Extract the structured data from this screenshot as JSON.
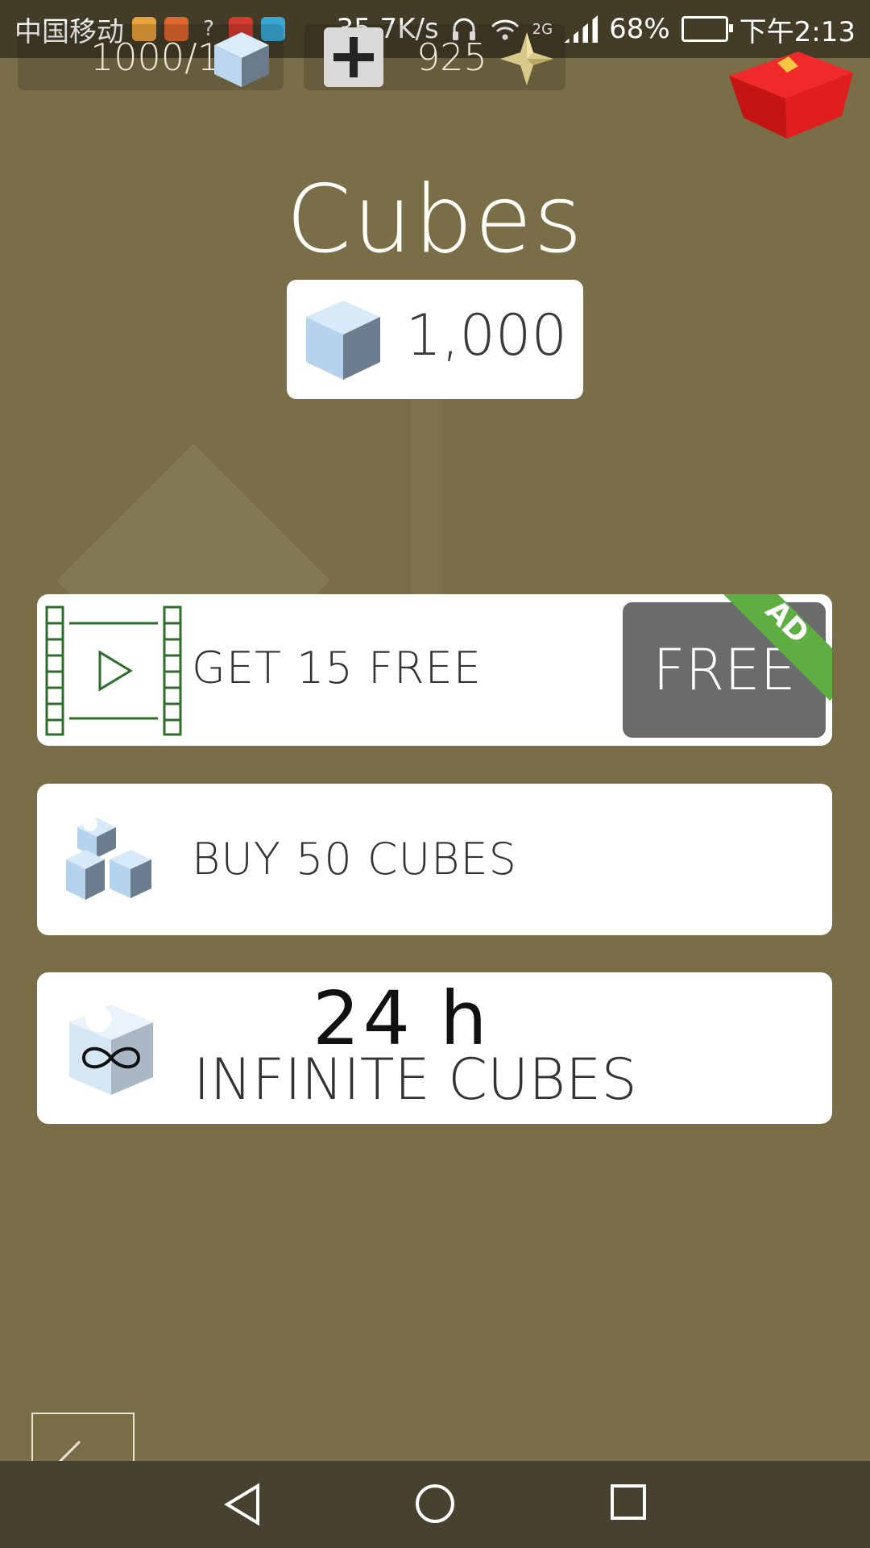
{
  "status_bar": {
    "carrier": "中国移动",
    "speed": "35.7K/s",
    "network": "2G",
    "battery": "68%",
    "time": "下午2:13"
  },
  "top_bar": {
    "cubes_counter": "1000/10",
    "stars_counter": "925"
  },
  "title": "Cubes",
  "cube_count": "1,000",
  "offers": {
    "ad": {
      "label": "GET 15 FREE",
      "button": "FREE",
      "badge": "AD"
    },
    "buy": {
      "label": "BUY 50 CUBES"
    },
    "infinite": {
      "hours": "24 h",
      "label": "INFINITE CUBES"
    }
  },
  "icons": [
    "back-arrow-icon",
    "nav-back-icon",
    "nav-home-icon",
    "nav-recents-icon",
    "gift-icon",
    "star-icon",
    "cube-icon"
  ],
  "colors": {
    "background": "#7a6e48",
    "card": "#ffffff",
    "free_button": "#6b6b6b",
    "ad_ribbon": "#5fae43",
    "film_icon": "#2e6e2a",
    "gift": "#e21c1c",
    "cube_light": "#b9d6ee",
    "cube_dark": "#6a7b8c"
  }
}
